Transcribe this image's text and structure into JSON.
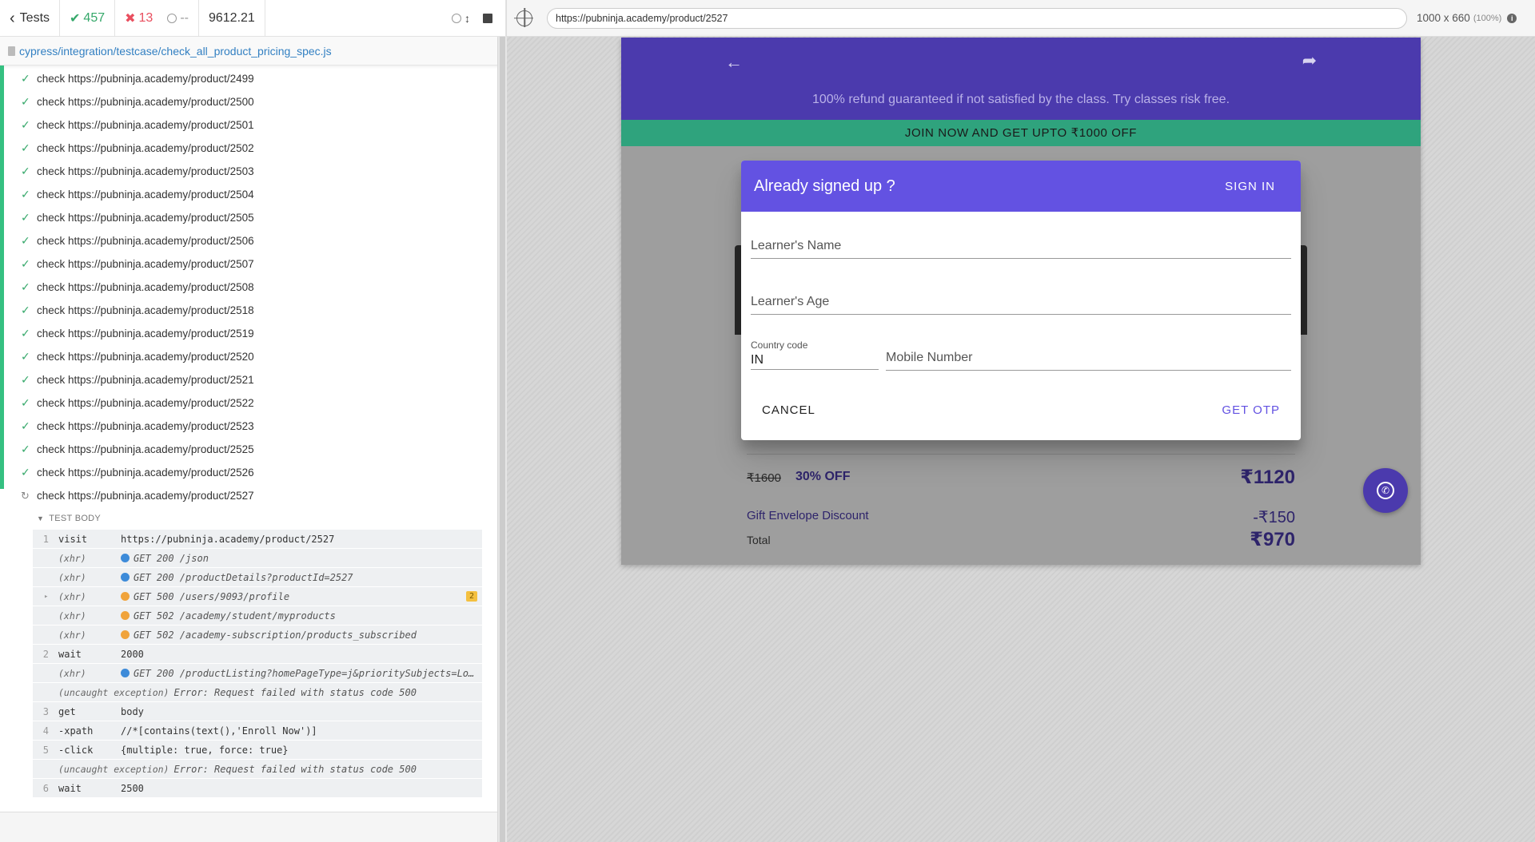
{
  "stats": {
    "back_label": "Tests",
    "passed": "457",
    "failed": "13",
    "pending": "--",
    "duration": "9612.21"
  },
  "spec": {
    "path": "cypress/integration/testcase/check_all_product_pricing_spec.js"
  },
  "tests": [
    "check https://pubninja.academy/product/2499",
    "check https://pubninja.academy/product/2500",
    "check https://pubninja.academy/product/2501",
    "check https://pubninja.academy/product/2502",
    "check https://pubninja.academy/product/2503",
    "check https://pubninja.academy/product/2504",
    "check https://pubninja.academy/product/2505",
    "check https://pubninja.academy/product/2506",
    "check https://pubninja.academy/product/2507",
    "check https://pubninja.academy/product/2508",
    "check https://pubninja.academy/product/2518",
    "check https://pubninja.academy/product/2519",
    "check https://pubninja.academy/product/2520",
    "check https://pubninja.academy/product/2521",
    "check https://pubninja.academy/product/2522",
    "check https://pubninja.academy/product/2523",
    "check https://pubninja.academy/product/2525",
    "check https://pubninja.academy/product/2526"
  ],
  "running_test": "check https://pubninja.academy/product/2527",
  "test_body_label": "TEST BODY",
  "commands": [
    {
      "num": "1",
      "name": "visit",
      "msg": "https://pubninja.academy/product/2527",
      "kind": "cmd"
    },
    {
      "num": "",
      "name": "(xhr)",
      "msg": "GET 200 /json",
      "kind": "xhr",
      "dot": "blue"
    },
    {
      "num": "",
      "name": "(xhr)",
      "msg": "GET 200 /productDetails?productId=2527",
      "kind": "xhr",
      "dot": "blue"
    },
    {
      "num": "",
      "name": "(xhr)",
      "msg": "GET 500 /users/9093/profile",
      "kind": "xhr",
      "dot": "orange",
      "badge": "2",
      "caret": true
    },
    {
      "num": "",
      "name": "(xhr)",
      "msg": "GET 502 /academy/student/myproducts",
      "kind": "xhr",
      "dot": "orange"
    },
    {
      "num": "",
      "name": "(xhr)",
      "msg": "GET 502 /academy-subscription/products_subscribed",
      "kind": "xhr",
      "dot": "orange"
    },
    {
      "num": "2",
      "name": "wait",
      "msg": "2000",
      "kind": "cmd"
    },
    {
      "num": "",
      "name": "(xhr)",
      "msg": "GET 200 /productListing?homePageType=j&prioritySubjects=Lo…",
      "kind": "xhr",
      "dot": "blue"
    },
    {
      "num": "",
      "name": "(uncaught exception)",
      "msg": "Error: Request failed with status code 500",
      "kind": "exc"
    },
    {
      "num": "3",
      "name": "get",
      "msg": "body",
      "kind": "cmd"
    },
    {
      "num": "4",
      "name": "-xpath",
      "msg": "//*[contains(text(),'Enroll Now')]",
      "kind": "cmd"
    },
    {
      "num": "5",
      "name": "-click",
      "msg": "{multiple: true, force: true}",
      "kind": "cmd"
    },
    {
      "num": "",
      "name": "(uncaught exception)",
      "msg": "Error: Request failed with status code 500",
      "kind": "exc"
    },
    {
      "num": "6",
      "name": "wait",
      "msg": "2500",
      "kind": "cmd"
    }
  ],
  "runner": {
    "url": "https://pubninja.academy/product/2527",
    "viewport": "1000 x 660",
    "zoom": "(100%)"
  },
  "app": {
    "refund_text": "100% refund guaranteed if not satisfied by the class. Try classes risk free.",
    "promo_text": "JOIN NOW AND GET UPTO ₹1000 OFF",
    "price_old": "₹1600",
    "price_off": "30% OFF",
    "price_new": "₹1120",
    "gift_label": "Gift Envelope Discount",
    "gift_value": "-₹150",
    "total_label": "Total",
    "total_value": "₹970",
    "colors": {
      "header": "#4b3aad",
      "promo": "#2fa37d",
      "dialog_header": "#6352e2"
    }
  },
  "dialog": {
    "title": "Already signed up ?",
    "signin_label": "SIGN IN",
    "name_placeholder": "Learner's Name",
    "age_placeholder": "Learner's Age",
    "country_label": "Country code",
    "country_value": "IN",
    "mobile_placeholder": "Mobile Number",
    "cancel_label": "CANCEL",
    "otp_label": "GET OTP"
  }
}
